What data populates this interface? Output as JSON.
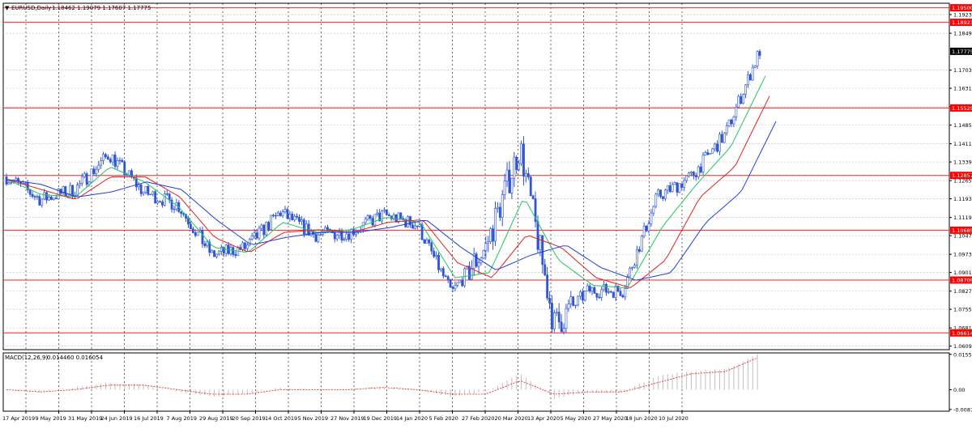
{
  "header": {
    "marker": "▼",
    "symbol": "EURUSD,Daily",
    "ohlc": "1.18462 1.19079 1.17607 1.17775"
  },
  "macd": {
    "label": "MACD(12,26,9)",
    "values": "0.014460 0.016054"
  },
  "colors": {
    "candles": "#2f55d4",
    "ma_fast": "#22c55e",
    "ma_mid": "#e02020",
    "ma_slow": "#1f3fe0",
    "level_line": "#ff2020",
    "level_tag": "#ff0000",
    "grid": "#c8c8c8",
    "vgrid": "#000000",
    "macd_hist": "#c0c0c0",
    "macd_signal": "#e02020",
    "current_tag": "#000000"
  },
  "chart_data": {
    "type": "line",
    "subtype": "candlestick-price-with-moving-averages",
    "instrument": "EURUSD",
    "timeframe": "Daily",
    "ylim": [
      1.0595,
      1.1968
    ],
    "y_ticks": [
      "1.19230",
      "1.18490",
      "1.17030",
      "1.16310",
      "1.15580",
      "1.14850",
      "1.14110",
      "1.13390",
      "1.12650",
      "1.11930",
      "1.11190",
      "1.10470",
      "1.09730",
      "1.09010",
      "1.08270",
      "1.07550",
      "1.06810",
      "1.06090"
    ],
    "x_ticks": [
      "17 Apr 2019",
      "9 May 2019",
      "31 May 2019",
      "24 Jun 2019",
      "16 Jul 2019",
      "7 Aug 2019",
      "29 Aug 2019",
      "20 Sep 2019",
      "14 Oct 2019",
      "5 Nov 2019",
      "27 Nov 2019",
      "19 Dec 2019",
      "14 Jan 2020",
      "5 Feb 2020",
      "27 Feb 2020",
      "20 Mar 2020",
      "13 Apr 2020",
      "5 May 2020",
      "27 May 2020",
      "18 Jun 2020",
      "10 Jul 2020"
    ],
    "levels": [
      "1.19500",
      "1.18923",
      "1.15529",
      "1.12857",
      "1.10685",
      "1.08709",
      "1.06614"
    ],
    "current_price": "1.17775",
    "close_series": {
      "name": "EURUSD",
      "x": [
        "17 Apr 2019",
        "9 May 2019",
        "31 May 2019",
        "24 Jun 2019",
        "16 Jul 2019",
        "7 Aug 2019",
        "29 Aug 2019",
        "20 Sep 2019",
        "14 Oct 2019",
        "5 Nov 2019",
        "27 Nov 2019",
        "19 Dec 2019",
        "14 Jan 2020",
        "5 Feb 2020",
        "27 Feb 2020",
        "9 Mar 2020",
        "20 Mar 2020",
        "13 Apr 2020",
        "5 May 2020",
        "27 May 2020",
        "18 Jun 2020",
        "10 Jul 2020",
        "21 Jul 2020"
      ],
      "values": [
        1.128,
        1.119,
        1.123,
        1.137,
        1.122,
        1.117,
        1.097,
        1.1,
        1.114,
        1.105,
        1.106,
        1.113,
        1.109,
        1.082,
        1.1,
        1.14,
        1.069,
        1.083,
        1.083,
        1.12,
        1.128,
        1.145,
        1.178
      ]
    },
    "ma_series": [
      {
        "values": [
          1.127,
          1.121,
          1.12,
          1.132,
          1.126,
          1.116,
          1.1,
          1.098,
          1.11,
          1.106,
          1.107,
          1.112,
          1.11,
          1.088,
          1.09,
          1.12,
          1.095,
          1.085,
          1.084,
          1.108,
          1.125,
          1.14,
          1.168
        ]
      },
      {
        "values": [
          1.127,
          1.123,
          1.119,
          1.128,
          1.128,
          1.12,
          1.104,
          1.098,
          1.106,
          1.107,
          1.106,
          1.11,
          1.111,
          1.094,
          1.088,
          1.105,
          1.1,
          1.088,
          1.084,
          1.095,
          1.12,
          1.132,
          1.16
        ]
      },
      {
        "values": [
          1.127,
          1.125,
          1.12,
          1.122,
          1.126,
          1.123,
          1.111,
          1.101,
          1.104,
          1.106,
          1.106,
          1.108,
          1.111,
          1.1,
          1.091,
          1.097,
          1.101,
          1.092,
          1.087,
          1.09,
          1.11,
          1.122,
          1.15
        ]
      }
    ],
    "macd_subwindow": {
      "ylim": [
        -0.0095,
        0.0162
      ],
      "y_ticks": [
        "0.015564",
        "0.00",
        "-0.00872"
      ],
      "histogram": [
        0.0,
        -0.001,
        0.001,
        0.003,
        0.002,
        -0.001,
        -0.003,
        -0.002,
        0.001,
        0.0,
        0.0,
        0.001,
        0.0,
        -0.003,
        -0.001,
        0.007,
        -0.004,
        -0.001,
        -0.001,
        0.006,
        0.008,
        0.009,
        0.016
      ],
      "signal": [
        0.0,
        -0.001,
        0.0,
        0.002,
        0.002,
        0.0,
        -0.002,
        -0.002,
        0.0,
        0.0,
        0.0,
        0.001,
        0.0,
        -0.002,
        -0.002,
        0.004,
        -0.002,
        -0.001,
        -0.001,
        0.003,
        0.007,
        0.008,
        0.0145
      ]
    }
  }
}
